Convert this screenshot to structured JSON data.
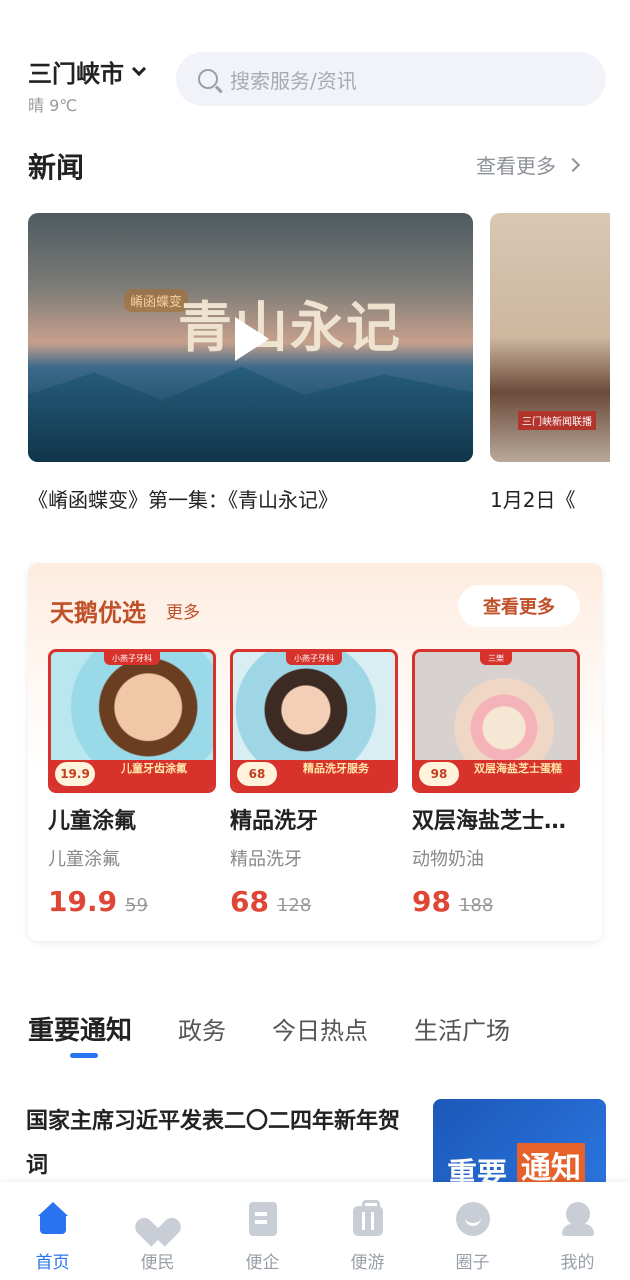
{
  "header": {
    "city": "三门峡市",
    "weather": "晴 9℃",
    "search_placeholder": "搜索服务/资讯"
  },
  "news": {
    "title": "新闻",
    "more": "查看更多",
    "items": [
      {
        "caption": "《崤函蝶变》第一集：《青山永记》",
        "cover_text": "青山永记",
        "cover_tag": "崤函蝶变"
      },
      {
        "caption": "1月2日《",
        "cover_text": "三门峡新闻联播"
      }
    ]
  },
  "promo": {
    "title": "天鹅优选",
    "sub": "更多",
    "button": "查看更多",
    "products": [
      {
        "name": "儿童涂氟",
        "desc": "儿童涂氟",
        "price": "19.9",
        "old_price": "59",
        "tag": "小燕子牙科",
        "banner": "儿童牙齿涂氟",
        "badge": "19.9"
      },
      {
        "name": "精品洗牙",
        "desc": "精品洗牙",
        "price": "68",
        "old_price": "128",
        "tag": "小燕子牙科",
        "banner": "精品洗牙服务",
        "badge": "68"
      },
      {
        "name": "双层海盐芝士蛋糕",
        "desc": "动物奶油",
        "price": "98",
        "old_price": "188",
        "tag": "三樂",
        "banner": "双层海盐芝士蛋糕",
        "badge": "98"
      }
    ]
  },
  "tabs": [
    "重要通知",
    "政务",
    "今日热点",
    "生活广场"
  ],
  "notice": {
    "title": "国家主席习近平发表二〇二四年新年贺词",
    "img_text_1": "重要",
    "img_text_2": "通知"
  },
  "nav": [
    {
      "label": "首页",
      "icon": "home-icon"
    },
    {
      "label": "便民",
      "icon": "heart-icon"
    },
    {
      "label": "便企",
      "icon": "document-icon"
    },
    {
      "label": "便游",
      "icon": "luggage-icon"
    },
    {
      "label": "圈子",
      "icon": "chat-icon"
    },
    {
      "label": "我的",
      "icon": "user-icon"
    }
  ],
  "colors": {
    "accent": "#2a73f0",
    "promo": "#c0502a",
    "price": "#e04636"
  }
}
